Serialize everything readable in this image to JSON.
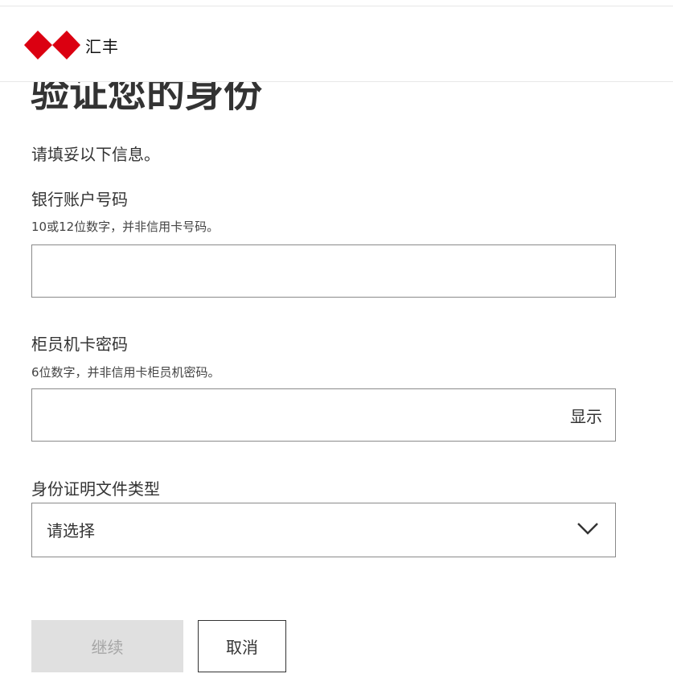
{
  "header": {
    "brand_name": "汇丰",
    "logo_icon": "hsbc-hexagon-logo-icon",
    "brand_color": "#db0011"
  },
  "page": {
    "title": "验证您的身份",
    "intro": "请填妥以下信息。"
  },
  "form": {
    "account": {
      "label": "银行账户号码",
      "hint": "10或12位数字，并非信用卡号码。",
      "value": ""
    },
    "pin": {
      "label": "柜员机卡密码",
      "hint": "6位数字，并非信用卡柜员机密码。",
      "value": "",
      "show_label": "显示"
    },
    "id_type": {
      "label": "身份证明文件类型",
      "selected": "请选择",
      "icon": "chevron-down-icon"
    }
  },
  "actions": {
    "continue_label": "继续",
    "cancel_label": "取消"
  },
  "colors": {
    "border": "#8a8a8a",
    "disabled_bg": "#e0e0e0",
    "disabled_text": "#a6a6a6"
  }
}
